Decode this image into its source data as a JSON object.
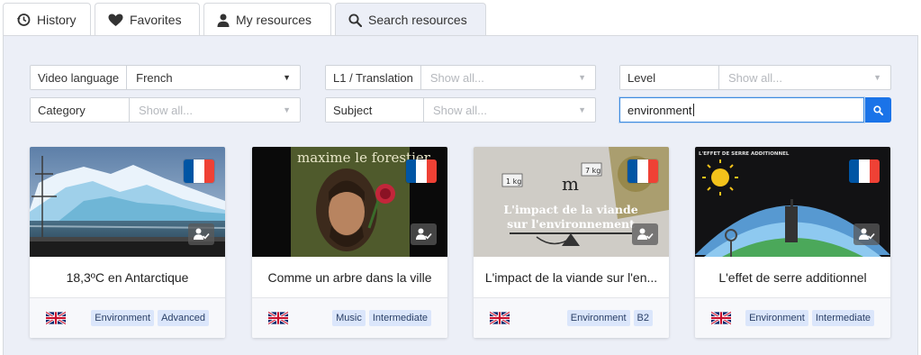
{
  "tabs": [
    {
      "label": "History",
      "icon": "history-icon"
    },
    {
      "label": "Favorites",
      "icon": "heart-icon"
    },
    {
      "label": "My resources",
      "icon": "person-icon"
    },
    {
      "label": "Search resources",
      "icon": "search-icon",
      "active": true
    }
  ],
  "filters": {
    "video_language": {
      "label": "Video language",
      "value": "French"
    },
    "l1_translation": {
      "label": "L1 / Translation",
      "placeholder": "Show all..."
    },
    "level": {
      "label": "Level",
      "placeholder": "Show all..."
    },
    "category": {
      "label": "Category",
      "placeholder": "Show all..."
    },
    "subject": {
      "label": "Subject",
      "placeholder": "Show all..."
    }
  },
  "search": {
    "value": "environment"
  },
  "thumbnail_texts": {
    "card2_artist": "maxime le forestier",
    "card3_line1": "L'impact de la viande",
    "card3_line2": "sur l'environnement",
    "card3_weight_left": "1 kg",
    "card3_weight_right": "7 kg",
    "card3_logo": "m",
    "card4_header": "L'EFFET DE SERRE ADDITIONNEL"
  },
  "cards": [
    {
      "title": "18,3ºC en Antarctique",
      "tags": [
        "Environment",
        "Advanced"
      ]
    },
    {
      "title": "Comme un arbre dans la ville",
      "tags": [
        "Music",
        "Intermediate"
      ]
    },
    {
      "title": "L'impact de la viande sur l'en...",
      "tags": [
        "Environment",
        "B2"
      ]
    },
    {
      "title": "L'effet de serre additionnel",
      "tags": [
        "Environment",
        "Intermediate"
      ]
    }
  ],
  "colors": {
    "panel_bg": "#eceff7",
    "accent": "#1a73e8",
    "tag_bg": "#dbe6fb",
    "flag_blue": "#0055a4",
    "flag_red": "#ef4135"
  }
}
